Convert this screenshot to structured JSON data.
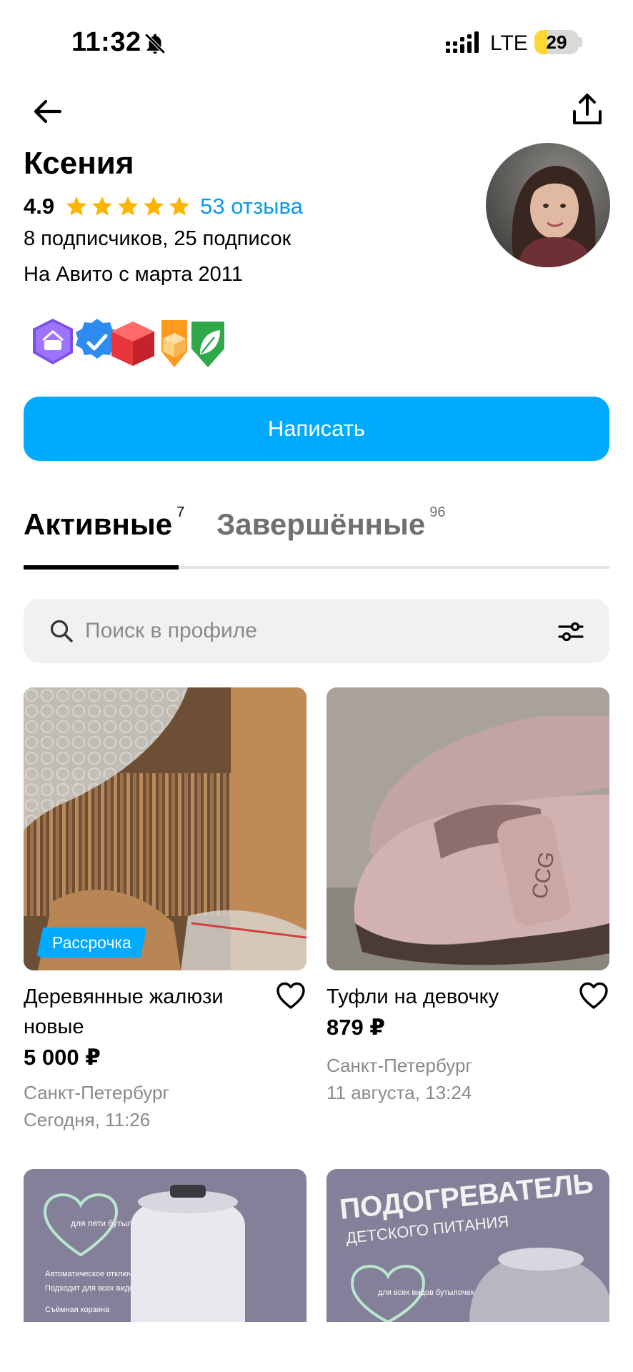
{
  "status_bar": {
    "time": "11:32",
    "network": "LTE",
    "battery": "29",
    "battery_level": 0.29,
    "icons": [
      "bell-off-icon",
      "signal-icon"
    ]
  },
  "nav": {
    "icons": [
      "back-arrow-icon",
      "share-icon"
    ]
  },
  "profile": {
    "name": "Ксения",
    "rating": "4.9",
    "stars": 5,
    "reviews_label": "53 отзыва",
    "subscribers": "8 подписчиков, 25 подписок",
    "since": "На Авито с марта 2011",
    "badges": [
      "basket-badge",
      "verified-badge",
      "box-badge",
      "delivery-badge",
      "eco-leaf-badge"
    ]
  },
  "write_button": {
    "label": "Написать"
  },
  "tabs": [
    {
      "label": "Активные",
      "count": "7",
      "active": true
    },
    {
      "label": "Завершённые",
      "count": "96",
      "active": false
    }
  ],
  "search": {
    "placeholder": "Поиск в профиле"
  },
  "listings": [
    {
      "title": "Деревянные жалюзи новые",
      "price": "5 000 ₽",
      "city": "Санкт-Петербург",
      "date": "Сегодня, 11:26",
      "tag": "Рассрочка"
    },
    {
      "title": "Туфли на девочку",
      "price": "879 ₽",
      "city": "Санкт-Петербург",
      "date": "11 августа, 13:24"
    },
    {
      "photo_text": [
        "для пяти бутылочек",
        "Автоматическое отключение",
        "Подходит для всех видов бутылочек",
        "Съёмная корзина"
      ]
    },
    {
      "photo_text": [
        "ПОДОГРЕВАТЕЛЬ",
        "ДЕТСКОГО ПИТАНИЯ",
        "для всех видов бутылочек"
      ]
    }
  ],
  "colors": {
    "accent": "#00aaff",
    "link": "#0a99e8",
    "star": "#ffb400",
    "muted": "#8a8a8a"
  }
}
